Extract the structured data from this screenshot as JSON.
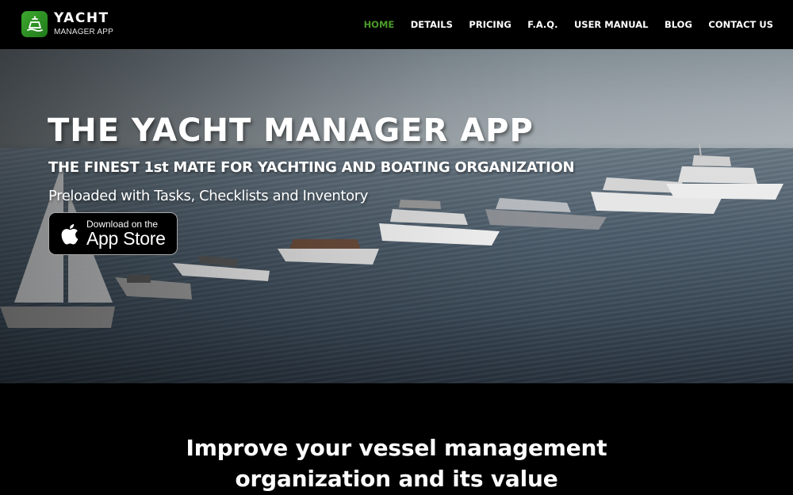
{
  "header": {
    "logo": {
      "icon": "yacht-icon",
      "title": "YACHT",
      "subtitle": "MANAGER APP",
      "brand_color": "#2e8b25"
    },
    "nav": [
      {
        "label": "HOME",
        "active": true
      },
      {
        "label": "DETAILS",
        "active": false
      },
      {
        "label": "PRICING",
        "active": false
      },
      {
        "label": "F.A.Q.",
        "active": false
      },
      {
        "label": "USER MANUAL",
        "active": false
      },
      {
        "label": "BLOG",
        "active": false
      },
      {
        "label": "CONTACT US",
        "active": false
      }
    ],
    "active_color": "#4c9a2a"
  },
  "hero": {
    "title": "THE YACHT MANAGER APP",
    "subtitle": "THE FINEST 1st MATE FOR YACHTING AND BOATING ORGANIZATION",
    "tagline": "Preloaded with Tasks, Checklists and Inventory",
    "app_store_button": {
      "icon": "apple-icon",
      "small_text": "Download on the",
      "big_text": "App Store"
    },
    "background": "photo of yachts and boats lined up on the sea"
  },
  "section": {
    "heading_line1": "Improve your vessel management",
    "heading_line2": "organization and its value"
  }
}
